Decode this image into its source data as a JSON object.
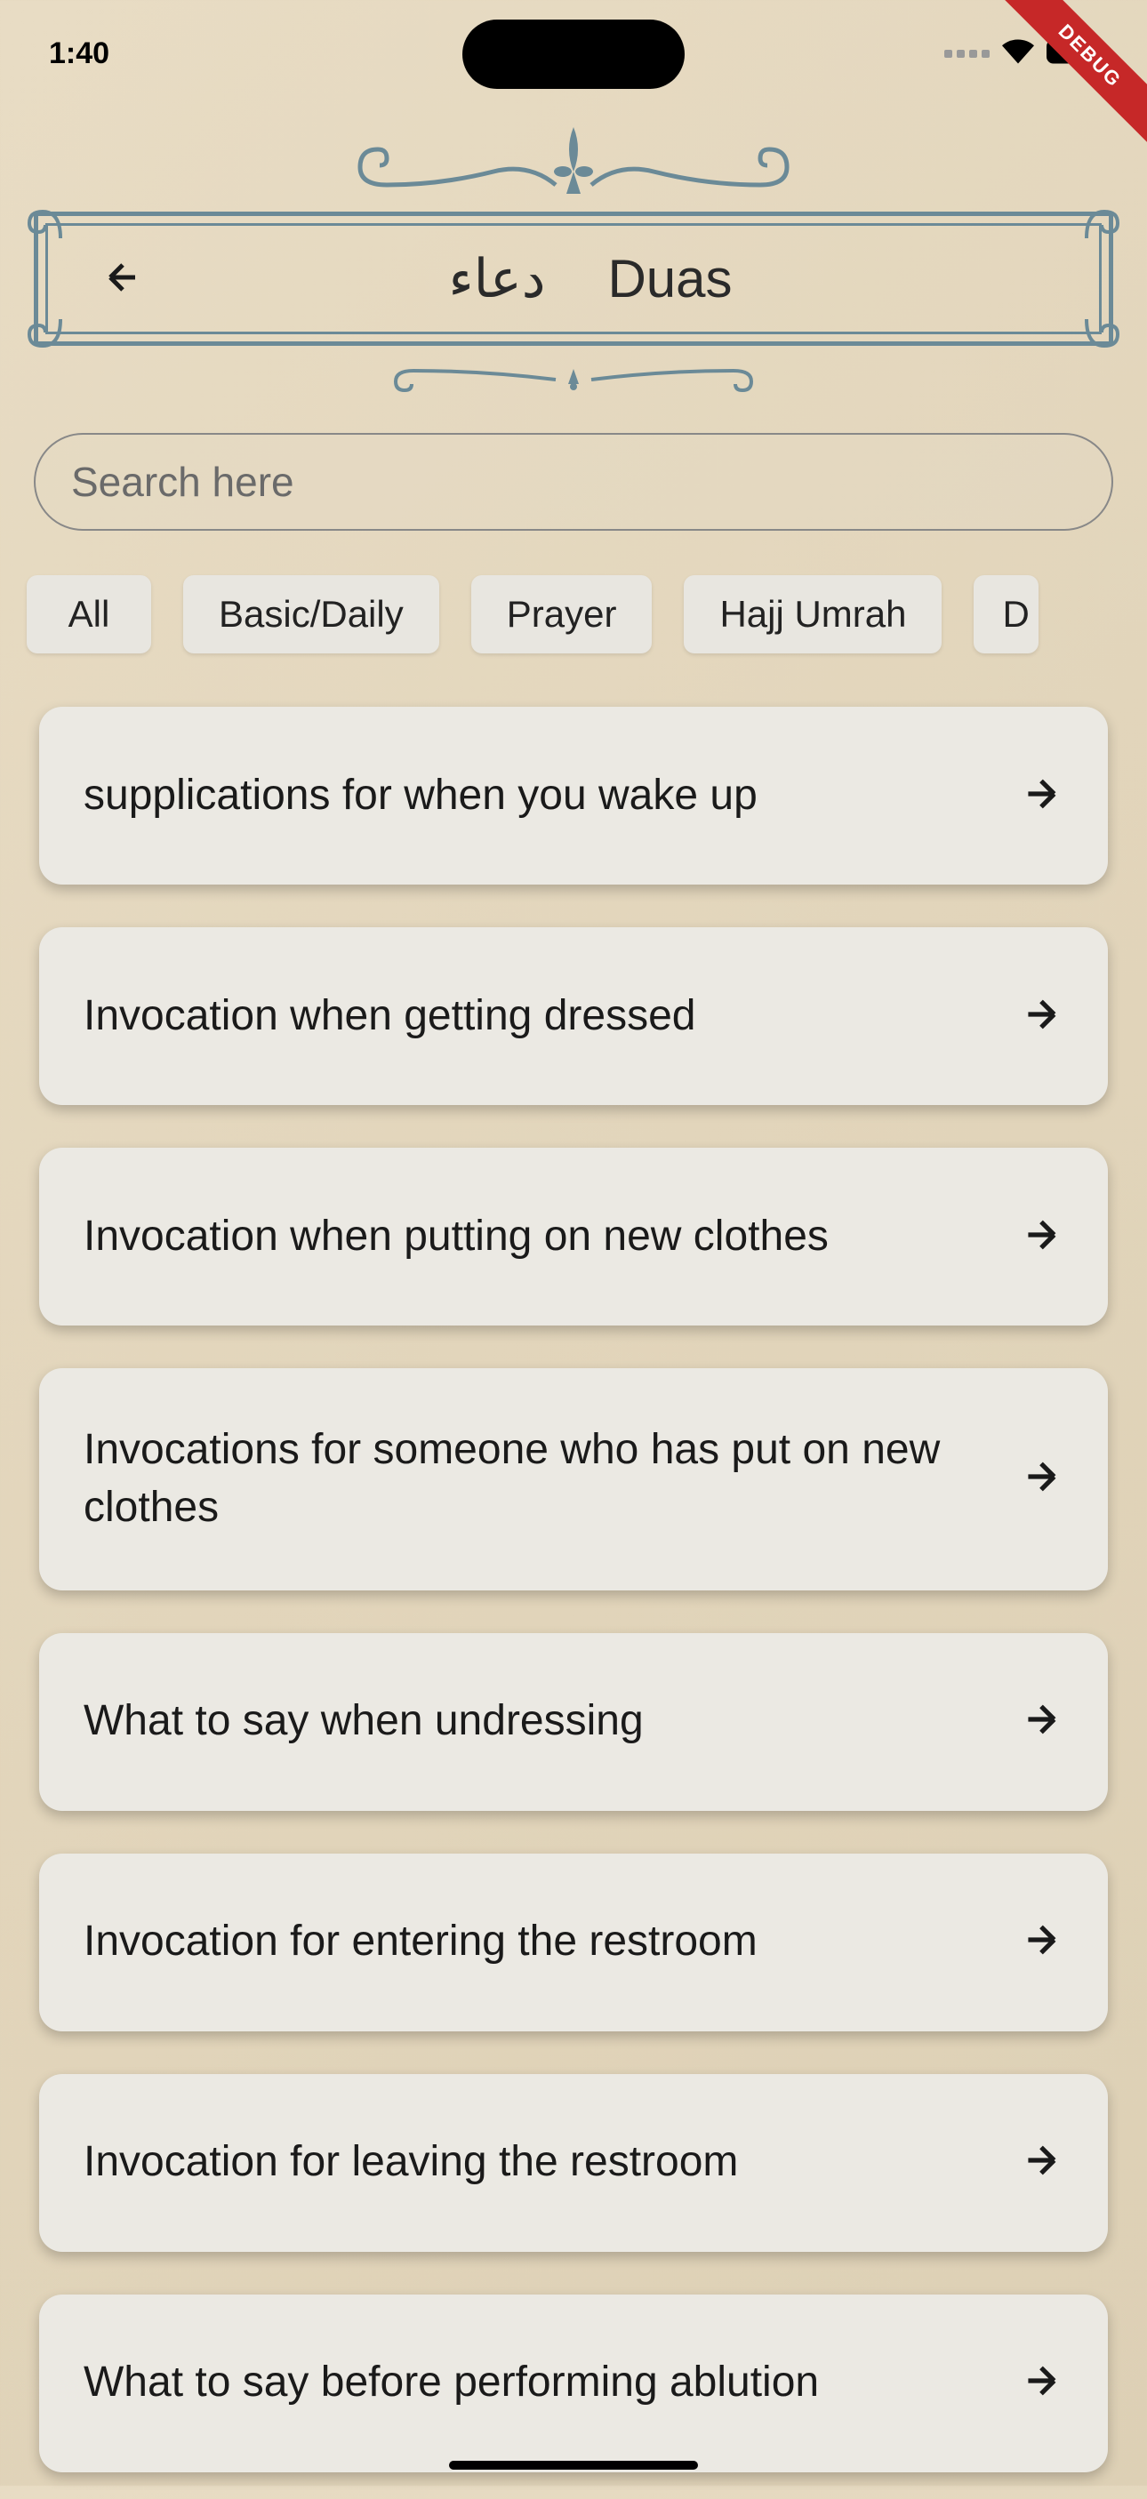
{
  "status": {
    "time": "1:40"
  },
  "debug_label": "DEBUG",
  "header": {
    "title_arabic": "دعاء",
    "title_english": "Duas"
  },
  "search": {
    "placeholder": "Search here"
  },
  "filters": [
    {
      "label": "All"
    },
    {
      "label": "Basic/Daily"
    },
    {
      "label": "Prayer"
    },
    {
      "label": "Hajj Umrah"
    },
    {
      "label": "D"
    }
  ],
  "items": [
    {
      "title": "supplications for when you wake up"
    },
    {
      "title": "Invocation when getting dressed"
    },
    {
      "title": "Invocation when putting on new clothes"
    },
    {
      "title": "Invocations for someone who has put on new clothes"
    },
    {
      "title": "What to say when undressing"
    },
    {
      "title": "Invocation for entering the restroom"
    },
    {
      "title": "Invocation for leaving the restroom"
    },
    {
      "title": "What to say before performing ablution"
    }
  ]
}
